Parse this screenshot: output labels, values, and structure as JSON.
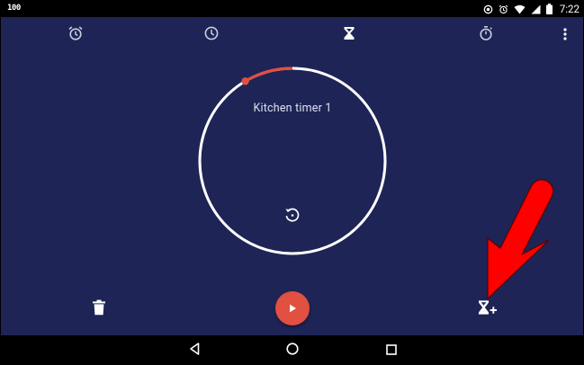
{
  "status_bar": {
    "battery_percent": "100",
    "time": "7:22",
    "icons": [
      "sync-icon",
      "alarm-icon",
      "wifi-icon",
      "signal-icon",
      "battery-icon"
    ]
  },
  "tabs": [
    {
      "name": "alarm",
      "icon": "alarm-icon",
      "selected": false
    },
    {
      "name": "clock",
      "icon": "clock-icon",
      "selected": false
    },
    {
      "name": "timer",
      "icon": "hourglass-icon",
      "selected": true
    },
    {
      "name": "stopwatch",
      "icon": "stopwatch-icon",
      "selected": false
    }
  ],
  "timer": {
    "label": "Kitchen timer 1",
    "elapsed_fraction": 0.085
  },
  "actions": {
    "delete_icon": "trash-icon",
    "play_icon": "play-icon",
    "add_icon": "add-timer-icon"
  },
  "navigation": {
    "icons": [
      "back-icon",
      "home-icon",
      "recents-icon"
    ]
  },
  "colors": {
    "background": "#1e2455",
    "accent": "#e15040",
    "ring": "#ffffff",
    "annotation_arrow": "#ff0000"
  }
}
